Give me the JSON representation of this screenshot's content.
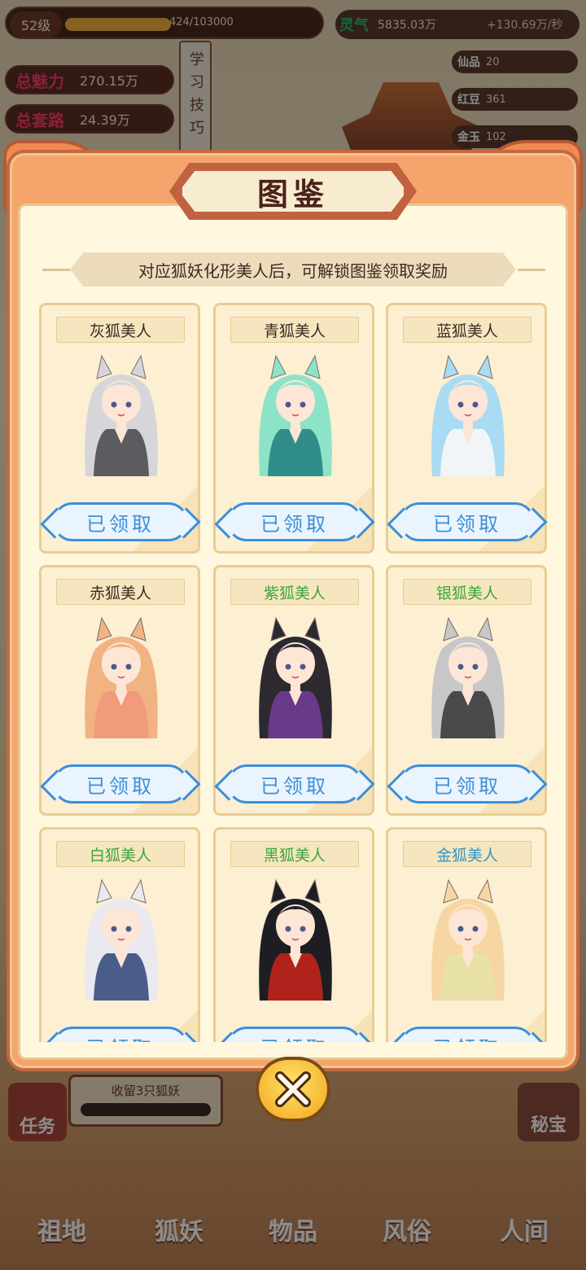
{
  "status_bar": {
    "level": "52级",
    "exp": "424/103000",
    "charm_label": "总魅力",
    "charm_value": "270.15万",
    "route_label": "总套路",
    "route_value": "24.39万",
    "study_label": "学习技巧",
    "spirit_label": "灵气",
    "spirit_value": "5835.03万",
    "spirit_rate": "+130.69万/秒",
    "resources": [
      {
        "label": "仙品",
        "value": "20"
      },
      {
        "label": "红豆",
        "value": "361"
      },
      {
        "label": "金玉",
        "value": "102"
      }
    ]
  },
  "modal": {
    "title": "图鉴",
    "subtitle": "对应狐妖化形美人后，可解锁图鉴领取奖励",
    "cards": [
      {
        "name": "灰狐美人",
        "button": "已领取",
        "hair": "#d6d6da",
        "robe": "#5b5b60",
        "name_color": "default"
      },
      {
        "name": "青狐美人",
        "button": "已领取",
        "hair": "#8de3c8",
        "robe": "#2f8e8a",
        "name_color": "default"
      },
      {
        "name": "蓝狐美人",
        "button": "已领取",
        "hair": "#a9dcf2",
        "robe": "#f1f5f7",
        "name_color": "default"
      },
      {
        "name": "赤狐美人",
        "button": "已领取",
        "hair": "#f2b383",
        "robe": "#f29a7c",
        "name_color": "default"
      },
      {
        "name": "紫狐美人",
        "button": "已领取",
        "hair": "#2c2a30",
        "robe": "#6a3a8a",
        "name_color": "green"
      },
      {
        "name": "银狐美人",
        "button": "已领取",
        "hair": "#c7c7c7",
        "robe": "#4a4a4a",
        "name_color": "green"
      },
      {
        "name": "白狐美人",
        "button": "已领取",
        "hair": "#e9e9ef",
        "robe": "#4a5d8a",
        "name_color": "green"
      },
      {
        "name": "黑狐美人",
        "button": "已领取",
        "hair": "#1e1e22",
        "robe": "#b2221d",
        "name_color": "green"
      },
      {
        "name": "金狐美人",
        "button": "已领取",
        "hair": "#f6d7a3",
        "robe": "#e8e2a8",
        "name_color": "cyan"
      }
    ]
  },
  "bottom": {
    "task_label": "任务",
    "collect_label": "收留3只狐妖",
    "treasure_label": "秘宝",
    "nav": [
      "祖地",
      "狐妖",
      "物品",
      "风俗",
      "人间"
    ]
  }
}
